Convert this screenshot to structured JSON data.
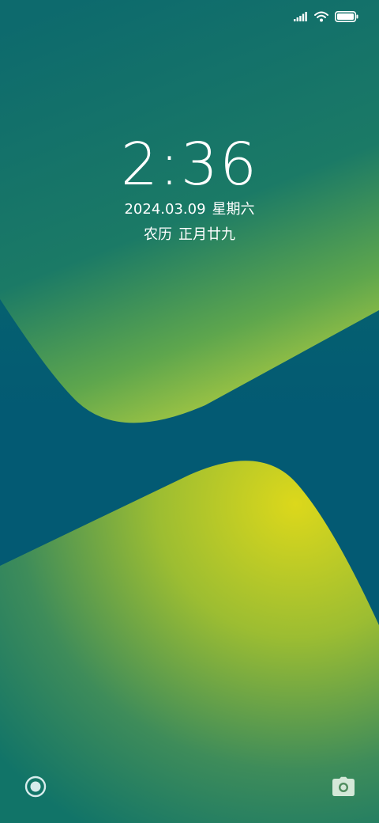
{
  "lock_screen": {
    "time": "2:36",
    "date": "2024.03.09",
    "weekday": "星期六",
    "lunar_label": "农历",
    "lunar_date": "正月廿九"
  },
  "icons": {
    "status": [
      "signal-icon",
      "wifi-icon",
      "battery-icon"
    ],
    "bottom_left": "voice-assistant-icon",
    "bottom_right": "camera-icon"
  },
  "colors": {
    "background": "#035a73",
    "text": "#ffffff",
    "wave_yellow": "#d9d51f",
    "wave_green": "#1f7d6c"
  }
}
